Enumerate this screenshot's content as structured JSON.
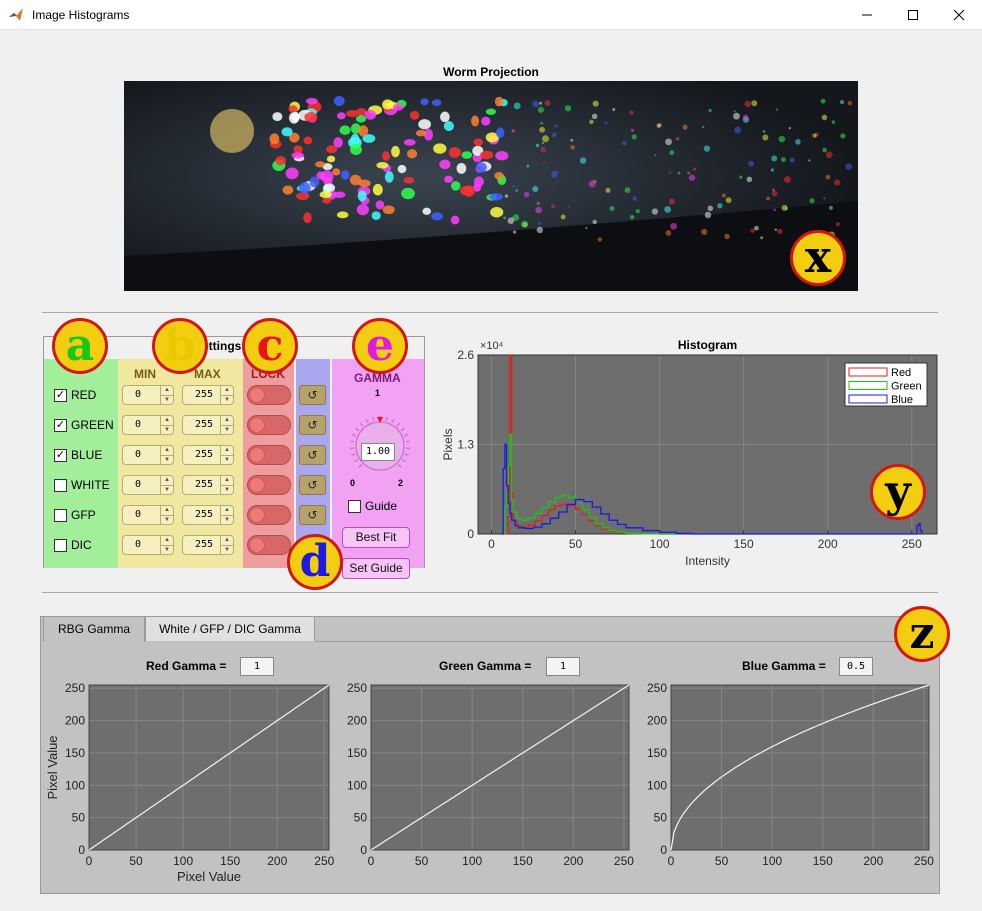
{
  "window": {
    "title": "Image Histograms"
  },
  "worm": {
    "title": "Worm Projection"
  },
  "settings": {
    "title": "Settings",
    "headers": {
      "min": "MIN",
      "max": "MAX",
      "lock": "LOCK",
      "gamma": "GAMMA"
    },
    "channels": [
      {
        "label": "RED",
        "checked": true,
        "min": "0",
        "max": "255"
      },
      {
        "label": "GREEN",
        "checked": true,
        "min": "0",
        "max": "255"
      },
      {
        "label": "BLUE",
        "checked": true,
        "min": "0",
        "max": "255"
      },
      {
        "label": "WHITE",
        "checked": false,
        "min": "0",
        "max": "255"
      },
      {
        "label": "GFP",
        "checked": false,
        "min": "0",
        "max": "255"
      },
      {
        "label": "DIC",
        "checked": false,
        "min": "0",
        "max": "255"
      }
    ],
    "reset_glyph": "↺",
    "gamma": {
      "value": "1.00",
      "tick_top": "1",
      "tick_left": "0",
      "tick_right": "2",
      "guide_label": "Guide",
      "best_fit": "Best Fit",
      "set_guide": "Set Guide"
    }
  },
  "badges": {
    "a": "a",
    "b": "b",
    "c": "c",
    "d": "d",
    "e": "e",
    "x": "x",
    "y": "y",
    "z": "z"
  },
  "tabs": [
    {
      "label": "RBG Gamma"
    },
    {
      "label": "White / GFP / DIC Gamma"
    }
  ],
  "gamma_panels": [
    {
      "label": "Red Gamma =",
      "value": "1"
    },
    {
      "label": "Green Gamma =",
      "value": "1"
    },
    {
      "label": "Blue Gamma =",
      "value": "0.5"
    }
  ],
  "colors": {
    "red": "#e0201e",
    "green": "#18c818",
    "blue": "#1a1ae0",
    "plot_bg": "#6e6e6e",
    "grid": "#868686"
  },
  "chart_data": [
    {
      "type": "line",
      "title": "Histogram",
      "xlabel": "Intensity",
      "ylabel": "Pixels",
      "y_exponent": "×10⁴",
      "xlim": [
        -8,
        265
      ],
      "ylim": [
        0,
        26000
      ],
      "xticks": [
        0,
        50,
        100,
        150,
        200,
        250
      ],
      "yticks": [
        0,
        13000,
        26000
      ],
      "ytick_labels": [
        "0",
        "1.3",
        "2.6"
      ],
      "grid": true,
      "legend": "top-right",
      "series": [
        {
          "name": "Red",
          "color": "#e0201e",
          "x": [
            6,
            7,
            8,
            9,
            10,
            11,
            12,
            13,
            15,
            18,
            22,
            26,
            30,
            34,
            38,
            42,
            46,
            50,
            54,
            58,
            62,
            66,
            70,
            75,
            80,
            85,
            90,
            100,
            110
          ],
          "y": [
            0,
            0,
            0,
            0,
            2500,
            26000,
            6000,
            2000,
            1200,
            1000,
            1300,
            1900,
            2700,
            3500,
            4100,
            4300,
            4100,
            3600,
            2800,
            1900,
            1200,
            700,
            400,
            200,
            100,
            60,
            30,
            0,
            0
          ]
        },
        {
          "name": "Green",
          "color": "#18c818",
          "x": [
            6,
            7,
            8,
            9,
            10,
            11,
            12,
            13,
            15,
            18,
            22,
            26,
            30,
            34,
            38,
            42,
            46,
            50,
            54,
            58,
            62,
            66,
            70,
            75,
            80,
            85,
            90,
            100,
            110
          ],
          "y": [
            0,
            0,
            4000,
            6000,
            10000,
            14500,
            5000,
            3200,
            2200,
            2000,
            2300,
            3000,
            3800,
            4600,
            5300,
            5600,
            5300,
            4500,
            3500,
            2400,
            1500,
            900,
            500,
            250,
            120,
            60,
            30,
            0,
            0
          ]
        },
        {
          "name": "Blue",
          "color": "#1a1ae0",
          "x": [
            6,
            7,
            8,
            9,
            10,
            11,
            12,
            14,
            16,
            20,
            25,
            30,
            35,
            40,
            45,
            50,
            55,
            60,
            65,
            70,
            75,
            80,
            90,
            100,
            110,
            120,
            250,
            252,
            253,
            254,
            255,
            256
          ],
          "y": [
            0,
            9500,
            13000,
            7000,
            4500,
            3000,
            2000,
            1200,
            900,
            800,
            1000,
            1500,
            2300,
            3200,
            4300,
            5000,
            4700,
            3900,
            2900,
            2000,
            1400,
            900,
            500,
            250,
            80,
            0,
            0,
            0,
            1200,
            1500,
            500,
            0
          ]
        }
      ]
    },
    {
      "type": "line",
      "title": "",
      "xlabel": "Pixel Value",
      "ylabel": "Pixel Value",
      "xlim": [
        0,
        255
      ],
      "ylim": [
        0,
        255
      ],
      "xticks": [
        0,
        50,
        100,
        150,
        200,
        250
      ],
      "yticks": [
        0,
        50,
        100,
        150,
        200,
        250
      ],
      "grid": true,
      "series": [
        {
          "gamma": 1,
          "color": "#f4f4f4"
        }
      ]
    },
    {
      "type": "line",
      "title": "",
      "xlabel": "",
      "ylabel": "",
      "xlim": [
        0,
        255
      ],
      "ylim": [
        0,
        255
      ],
      "xticks": [
        0,
        50,
        100,
        150,
        200,
        250
      ],
      "yticks": [
        0,
        50,
        100,
        150,
        200,
        250
      ],
      "grid": true,
      "series": [
        {
          "gamma": 1,
          "color": "#f4f4f4"
        }
      ]
    },
    {
      "type": "line",
      "title": "",
      "xlabel": "",
      "ylabel": "",
      "xlim": [
        0,
        255
      ],
      "ylim": [
        0,
        255
      ],
      "xticks": [
        0,
        50,
        100,
        150,
        200,
        250
      ],
      "yticks": [
        0,
        50,
        100,
        150,
        200,
        250
      ],
      "grid": true,
      "series": [
        {
          "gamma": 0.5,
          "color": "#f4f4f4"
        }
      ]
    }
  ]
}
